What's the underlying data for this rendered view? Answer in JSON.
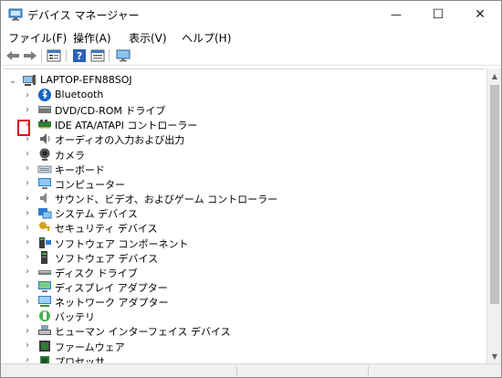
{
  "window": {
    "title": "デバイス マネージャー",
    "minimize_glyph": "—",
    "maximize_glyph": "☐",
    "close_glyph": "✕"
  },
  "menu": [
    {
      "label": "ファイル(F)"
    },
    {
      "label": "操作(A)"
    },
    {
      "label": "表示(V)"
    },
    {
      "label": "ヘルプ(H)"
    }
  ],
  "toolbar": {
    "buttons": [
      "back-arrow-icon",
      "forward-arrow-icon",
      "properties-icon",
      "help-icon",
      "view-icon",
      "monitor-icon"
    ]
  },
  "tree": {
    "root": {
      "label": "LAPTOP-EFN88SOJ",
      "expanded": true,
      "icon": "computer-icon"
    },
    "items": [
      {
        "label": "Bluetooth",
        "icon": "bluetooth-icon"
      },
      {
        "label": "DVD/CD-ROM ドライブ",
        "icon": "disc-drive-icon"
      },
      {
        "label": "IDE ATA/ATAPI コントローラー",
        "icon": "ide-controller-icon"
      },
      {
        "label": "オーディオの入力および出力",
        "icon": "speaker-icon"
      },
      {
        "label": "カメラ",
        "icon": "camera-icon"
      },
      {
        "label": "キーボード",
        "icon": "keyboard-icon"
      },
      {
        "label": "コンピューター",
        "icon": "computer-monitor-icon"
      },
      {
        "label": "サウンド、ビデオ、およびゲーム コントローラー",
        "icon": "sound-icon",
        "highlighted": true
      },
      {
        "label": "システム デバイス",
        "icon": "system-device-icon"
      },
      {
        "label": "セキュリティ デバイス",
        "icon": "security-key-icon"
      },
      {
        "label": "ソフトウェア コンポーネント",
        "icon": "software-component-icon"
      },
      {
        "label": "ソフトウェア デバイス",
        "icon": "software-device-icon"
      },
      {
        "label": "ディスク ドライブ",
        "icon": "disk-drive-icon"
      },
      {
        "label": "ディスプレイ アダプター",
        "icon": "display-adapter-icon"
      },
      {
        "label": "ネットワーク アダプター",
        "icon": "network-adapter-icon"
      },
      {
        "label": "バッテリ",
        "icon": "battery-icon"
      },
      {
        "label": "ヒューマン インターフェイス デバイス",
        "icon": "hid-icon"
      },
      {
        "label": "ファームウェア",
        "icon": "firmware-icon"
      },
      {
        "label": "プロセッサ",
        "icon": "processor-icon"
      }
    ]
  },
  "colors": {
    "highlight_border": "#e0001b",
    "accent_blue": "#1a73c8"
  }
}
